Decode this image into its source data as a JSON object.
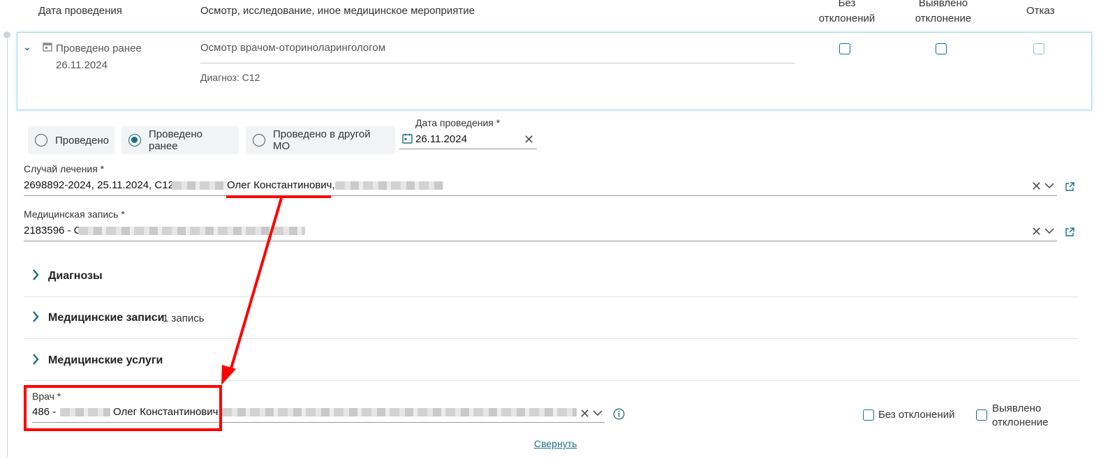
{
  "table_header": {
    "date": "Дата проведения",
    "exam": "Осмотр, исследование, иное медицинское мероприятие",
    "no_deviation": [
      "Без",
      "отклонений"
    ],
    "deviation": [
      "Выявлено",
      "отклонение"
    ],
    "refusal": "Отказ"
  },
  "card": {
    "status": "Проведено ранее",
    "date": "26.11.2024",
    "exam_name": "Осмотр врачом-оториноларингологом",
    "diagnosis": "Диагноз: C12"
  },
  "radios": {
    "done": "Проведено",
    "done_earlier": "Проведено ранее",
    "done_other_mo": "Проведено в другой МО",
    "selected": "Проведено ранее"
  },
  "date_field": {
    "label": "Дата проведения *",
    "value": "26.11.2024"
  },
  "case": {
    "label": "Случай лечения *",
    "value_prefix": "2698892-2024, 25.11.2024, C12,",
    "value_name": "Олег Константинович,"
  },
  "med_record": {
    "label": "Медицинская запись *",
    "value_prefix": "2183596 - С"
  },
  "sections": {
    "diagnoses": "Диагнозы",
    "med_records": "Медицинские записи",
    "med_records_count": "1 запись",
    "med_services": "Медицинские услуги"
  },
  "doctor": {
    "label": "Врач *",
    "value_prefix": "486 -",
    "value_name": "Олег Константинович"
  },
  "bottom_checks": {
    "no_deviation": "Без отклонений",
    "deviation": [
      "Выявлено",
      "отклонение"
    ]
  },
  "collapse_link": "Свернуть",
  "colors": {
    "accent": "#1b6f85",
    "annotation": "#ff0000"
  }
}
